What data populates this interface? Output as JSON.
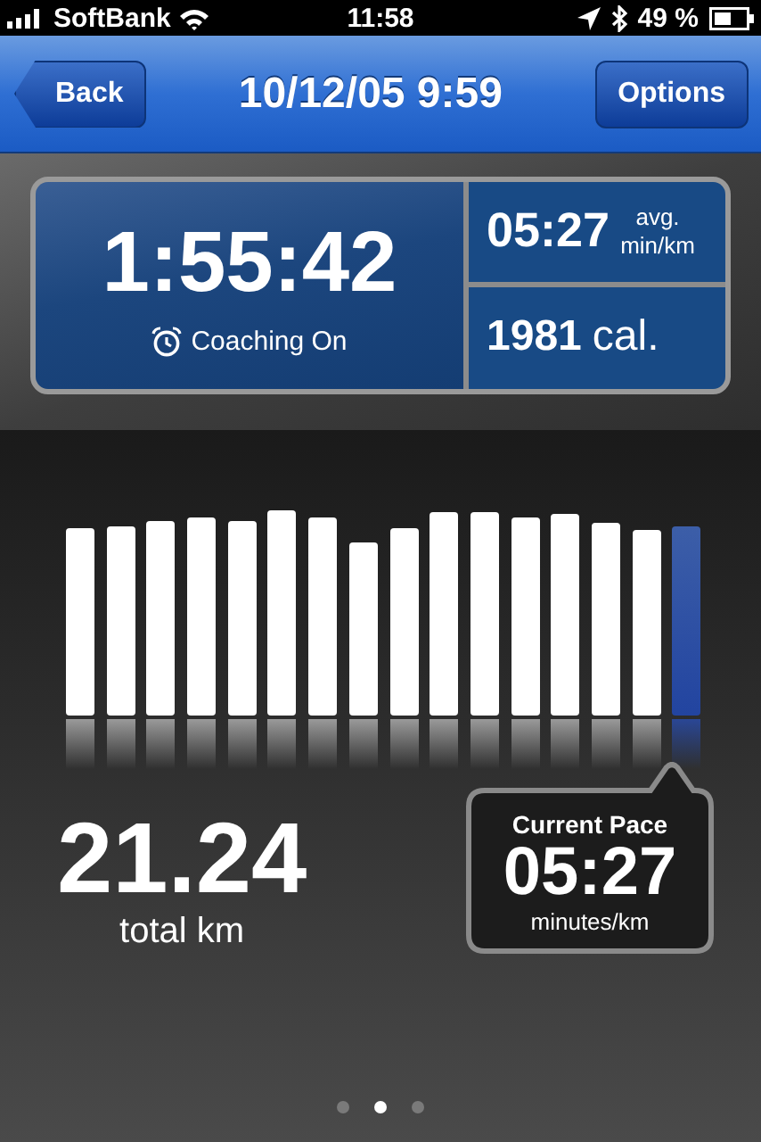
{
  "status_bar": {
    "carrier": "SoftBank",
    "time": "11:58",
    "battery": "49 %"
  },
  "nav": {
    "back": "Back",
    "title": "10/12/05 9:59",
    "options": "Options"
  },
  "summary": {
    "duration": "1:55:42",
    "coaching": "Coaching On",
    "avg_pace": "05:27",
    "avg_label": "avg.",
    "avg_unit": "min/km",
    "calories": "1981",
    "calories_unit": "cal."
  },
  "splits": [
    {
      "selected": false
    },
    {
      "selected": false
    },
    {
      "selected": false
    },
    {
      "selected": false
    },
    {
      "selected": false
    },
    {
      "selected": false
    },
    {
      "selected": false
    },
    {
      "selected": false
    },
    {
      "selected": false
    },
    {
      "selected": false
    },
    {
      "selected": false
    },
    {
      "selected": false
    },
    {
      "selected": false
    },
    {
      "selected": false
    },
    {
      "selected": false
    },
    {
      "selected": true
    }
  ],
  "distance": {
    "value": "21.24",
    "unit": "total km"
  },
  "current_pace": {
    "title": "Current Pace",
    "value": "05:27",
    "unit": "minutes/km"
  },
  "pages": [
    {
      "selected": false
    },
    {
      "selected": true
    },
    {
      "selected": false
    }
  ]
}
